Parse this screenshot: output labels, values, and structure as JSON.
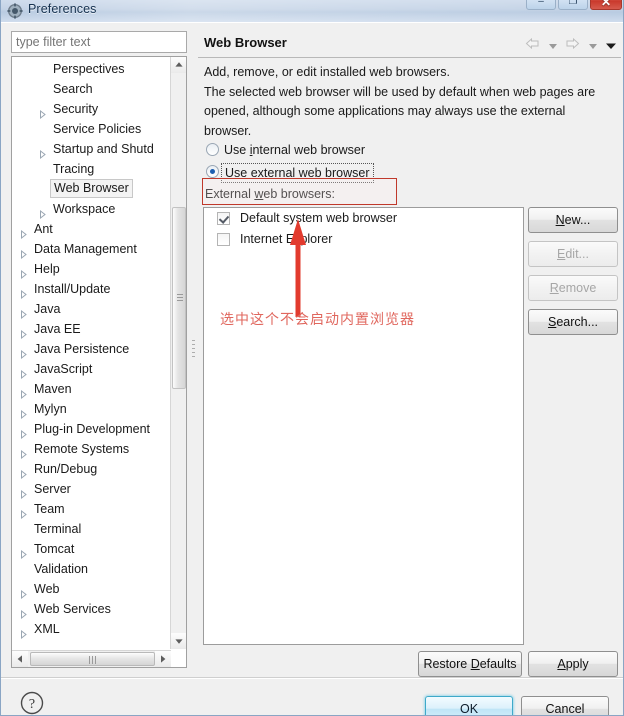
{
  "window": {
    "title": "Preferences",
    "icon": "gear-icon",
    "controls": {
      "minimize": "–",
      "maximize": "❐",
      "close": "✕"
    }
  },
  "sidebar": {
    "filter": {
      "value": "",
      "placeholder": "type filter text"
    },
    "tree": [
      {
        "label": "Perspectives",
        "depth": 2,
        "expandable": false,
        "selected": false
      },
      {
        "label": "Search",
        "depth": 2,
        "expandable": false,
        "selected": false
      },
      {
        "label": "Security",
        "depth": 2,
        "expandable": true,
        "selected": false
      },
      {
        "label": "Service Policies",
        "depth": 2,
        "expandable": false,
        "selected": false
      },
      {
        "label": "Startup and Shutd",
        "depth": 2,
        "expandable": true,
        "selected": false
      },
      {
        "label": "Tracing",
        "depth": 2,
        "expandable": false,
        "selected": false
      },
      {
        "label": "Web Browser",
        "depth": 2,
        "expandable": false,
        "selected": true
      },
      {
        "label": "Workspace",
        "depth": 2,
        "expandable": true,
        "selected": false
      },
      {
        "label": "Ant",
        "depth": 1,
        "expandable": true,
        "selected": false
      },
      {
        "label": "Data Management",
        "depth": 1,
        "expandable": true,
        "selected": false
      },
      {
        "label": "Help",
        "depth": 1,
        "expandable": true,
        "selected": false
      },
      {
        "label": "Install/Update",
        "depth": 1,
        "expandable": true,
        "selected": false
      },
      {
        "label": "Java",
        "depth": 1,
        "expandable": true,
        "selected": false
      },
      {
        "label": "Java EE",
        "depth": 1,
        "expandable": true,
        "selected": false
      },
      {
        "label": "Java Persistence",
        "depth": 1,
        "expandable": true,
        "selected": false
      },
      {
        "label": "JavaScript",
        "depth": 1,
        "expandable": true,
        "selected": false
      },
      {
        "label": "Maven",
        "depth": 1,
        "expandable": true,
        "selected": false
      },
      {
        "label": "Mylyn",
        "depth": 1,
        "expandable": true,
        "selected": false
      },
      {
        "label": "Plug-in Development",
        "depth": 1,
        "expandable": true,
        "selected": false
      },
      {
        "label": "Remote Systems",
        "depth": 1,
        "expandable": true,
        "selected": false
      },
      {
        "label": "Run/Debug",
        "depth": 1,
        "expandable": true,
        "selected": false
      },
      {
        "label": "Server",
        "depth": 1,
        "expandable": true,
        "selected": false
      },
      {
        "label": "Team",
        "depth": 1,
        "expandable": true,
        "selected": false
      },
      {
        "label": "Terminal",
        "depth": 1,
        "expandable": false,
        "selected": false
      },
      {
        "label": "Tomcat",
        "depth": 1,
        "expandable": true,
        "selected": false
      },
      {
        "label": "Validation",
        "depth": 1,
        "expandable": false,
        "selected": false
      },
      {
        "label": "Web",
        "depth": 1,
        "expandable": true,
        "selected": false
      },
      {
        "label": "Web Services",
        "depth": 1,
        "expandable": true,
        "selected": false
      },
      {
        "label": "XML",
        "depth": 1,
        "expandable": true,
        "selected": false
      }
    ]
  },
  "page": {
    "title": "Web Browser",
    "description_lines": [
      "Add, remove, or edit installed web browsers.",
      "The selected web browser will be used by default when web pages are",
      "opened, although some applications may always use the external",
      "browser."
    ],
    "nav": {
      "back_icon": "arrow-left-icon",
      "back_menu_icon": "chevron-down-icon",
      "forward_icon": "arrow-right-icon",
      "forward_menu_icon": "chevron-down-icon",
      "view_menu_icon": "chevron-down-icon"
    },
    "radios": [
      {
        "label_pre": "Use ",
        "mnemonic": "i",
        "label_post": "nternal web browser",
        "selected": false
      },
      {
        "label_pre": "Use e",
        "mnemonic": "x",
        "label_post": "ternal web browser",
        "selected": true
      }
    ],
    "list_label_pre": "External ",
    "list_label_mnemonic": "w",
    "list_label_post": "eb browsers:",
    "browsers": [
      {
        "label": "Default system web browser",
        "checked": true
      },
      {
        "label": "Internet Explorer",
        "checked": false
      }
    ],
    "side_buttons": [
      {
        "pre": "",
        "mnemonic": "N",
        "post": "ew...",
        "enabled": true
      },
      {
        "pre": "",
        "mnemonic": "E",
        "post": "dit...",
        "enabled": false
      },
      {
        "pre": "",
        "mnemonic": "R",
        "post": "emove",
        "enabled": false
      },
      {
        "pre": "",
        "mnemonic": "S",
        "post": "earch...",
        "enabled": true
      }
    ],
    "restore_defaults": {
      "pre": "Restore ",
      "mnemonic": "D",
      "post": "efaults"
    },
    "apply": {
      "pre": "",
      "mnemonic": "A",
      "post": "pply"
    }
  },
  "annotation": {
    "text": "选中这个不会启动内置浏览器",
    "color": "#e0675e",
    "rect_color": "#c0392b",
    "arrow_icon": "red-up-arrow-icon"
  },
  "footer": {
    "help_icon": "question-mark-icon",
    "ok": "OK",
    "cancel": "Cancel"
  }
}
